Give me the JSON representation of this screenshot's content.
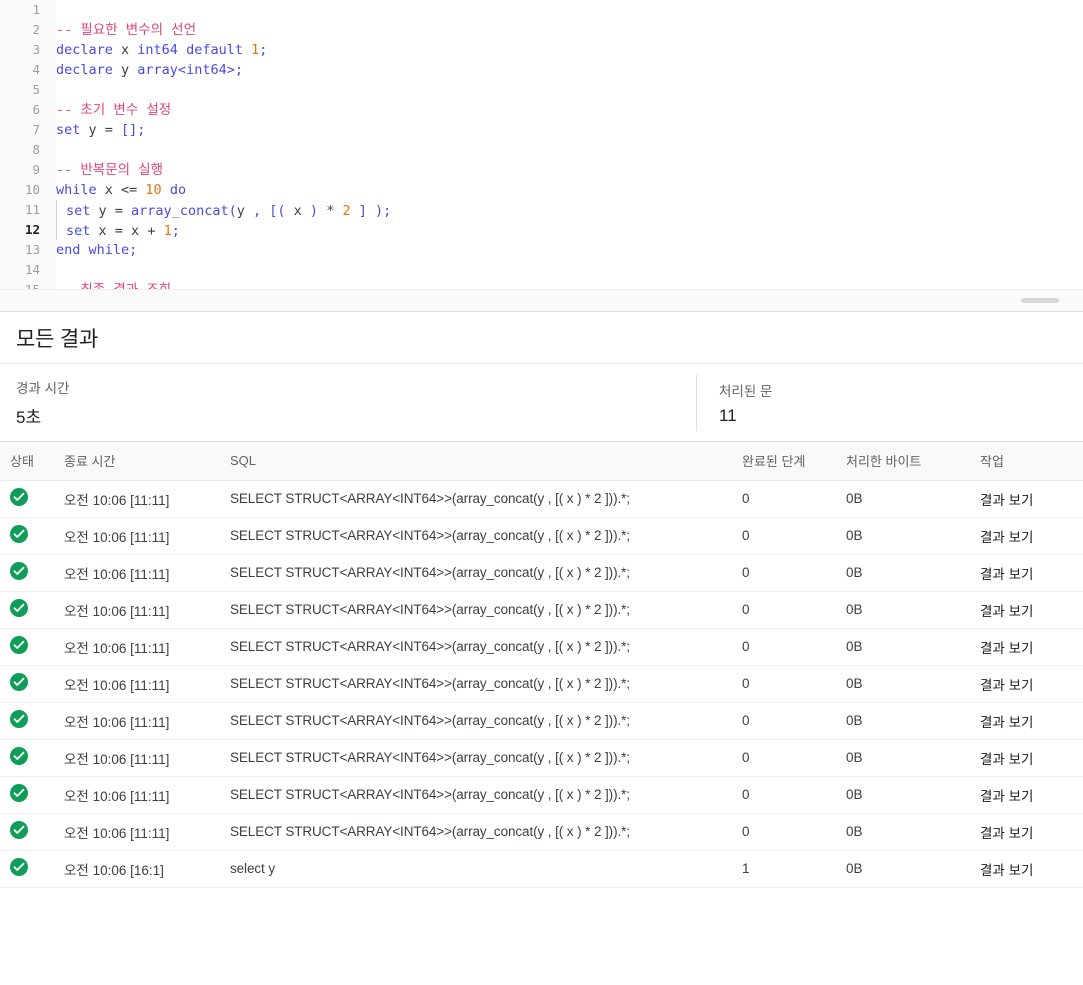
{
  "editor": {
    "name": "sql-script-editor",
    "language": "bigquery-sql",
    "active_line": 12,
    "lines": [
      {
        "n": "1",
        "tokens": []
      },
      {
        "n": "2",
        "tokens": [
          {
            "t": "com",
            "v": "-- 필요한 변수의 선언"
          }
        ]
      },
      {
        "n": "3",
        "tokens": [
          {
            "t": "kw",
            "v": "declare"
          },
          {
            "t": "id",
            "v": " x "
          },
          {
            "t": "type",
            "v": "int64"
          },
          {
            "t": "id",
            "v": " "
          },
          {
            "t": "kw",
            "v": "default"
          },
          {
            "t": "id",
            "v": " "
          },
          {
            "t": "num",
            "v": "1"
          },
          {
            "t": "pun",
            "v": ";"
          }
        ]
      },
      {
        "n": "4",
        "tokens": [
          {
            "t": "kw",
            "v": "declare"
          },
          {
            "t": "id",
            "v": " y "
          },
          {
            "t": "type",
            "v": "array<int64>"
          },
          {
            "t": "pun",
            "v": ";"
          }
        ]
      },
      {
        "n": "5",
        "tokens": []
      },
      {
        "n": "6",
        "tokens": [
          {
            "t": "com",
            "v": "-- 초기 변수 설정"
          }
        ]
      },
      {
        "n": "7",
        "tokens": [
          {
            "t": "kw",
            "v": "set"
          },
          {
            "t": "id",
            "v": " y "
          },
          {
            "t": "op",
            "v": "= "
          },
          {
            "t": "pun",
            "v": "[];"
          }
        ]
      },
      {
        "n": "8",
        "tokens": []
      },
      {
        "n": "9",
        "tokens": [
          {
            "t": "com",
            "v": "-- 반복문의 실행"
          }
        ]
      },
      {
        "n": "10",
        "tokens": [
          {
            "t": "kw",
            "v": "while"
          },
          {
            "t": "id",
            "v": " x "
          },
          {
            "t": "op",
            "v": "<= "
          },
          {
            "t": "num",
            "v": "10"
          },
          {
            "t": "kw",
            "v": " do"
          }
        ]
      },
      {
        "n": "11",
        "indent": true,
        "tokens": [
          {
            "t": "kw",
            "v": "set"
          },
          {
            "t": "id",
            "v": " y "
          },
          {
            "t": "op",
            "v": "= "
          },
          {
            "t": "fn",
            "v": "array_concat"
          },
          {
            "t": "pun",
            "v": "("
          },
          {
            "t": "id",
            "v": "y "
          },
          {
            "t": "pun",
            "v": ", ["
          },
          {
            "t": "pun",
            "v": "( "
          },
          {
            "t": "id",
            "v": "x "
          },
          {
            "t": "pun",
            "v": ") "
          },
          {
            "t": "op",
            "v": "* "
          },
          {
            "t": "num",
            "v": "2"
          },
          {
            "t": "pun",
            "v": " ] );"
          }
        ]
      },
      {
        "n": "12",
        "indent": true,
        "active": true,
        "tokens": [
          {
            "t": "kw",
            "v": "set"
          },
          {
            "t": "id",
            "v": " x "
          },
          {
            "t": "op",
            "v": "= "
          },
          {
            "t": "id",
            "v": "x "
          },
          {
            "t": "op",
            "v": "+ "
          },
          {
            "t": "num",
            "v": "1"
          },
          {
            "t": "pun",
            "v": ";"
          }
        ]
      },
      {
        "n": "13",
        "tokens": [
          {
            "t": "kw",
            "v": "end while"
          },
          {
            "t": "pun",
            "v": ";"
          }
        ]
      },
      {
        "n": "14",
        "tokens": []
      },
      {
        "n": "15",
        "tokens": [
          {
            "t": "com",
            "v": "-- 최종 결과 조회"
          }
        ]
      }
    ],
    "resize_handle_name": "editor-resize-handle"
  },
  "results": {
    "title": "모든 결과",
    "stats": [
      {
        "label": "경과 시간",
        "value": "5초"
      },
      {
        "label": "처리된 문",
        "value": "11"
      }
    ],
    "table": {
      "headers": {
        "status": "상태",
        "end_time": "종료 시간",
        "sql": "SQL",
        "stages": "완료된 단계",
        "bytes": "처리한 바이트",
        "action": "작업"
      },
      "rows": [
        {
          "status": "success",
          "end_time": "오전 10:06 [11:11]",
          "sql": "SELECT STRUCT<ARRAY<INT64>>(array_concat(y , [( x ) * 2 ])).*;",
          "stages": "0",
          "bytes": "0B",
          "action": "결과 보기"
        },
        {
          "status": "success",
          "end_time": "오전 10:06 [11:11]",
          "sql": "SELECT STRUCT<ARRAY<INT64>>(array_concat(y , [( x ) * 2 ])).*;",
          "stages": "0",
          "bytes": "0B",
          "action": "결과 보기"
        },
        {
          "status": "success",
          "end_time": "오전 10:06 [11:11]",
          "sql": "SELECT STRUCT<ARRAY<INT64>>(array_concat(y , [( x ) * 2 ])).*;",
          "stages": "0",
          "bytes": "0B",
          "action": "결과 보기"
        },
        {
          "status": "success",
          "end_time": "오전 10:06 [11:11]",
          "sql": "SELECT STRUCT<ARRAY<INT64>>(array_concat(y , [( x ) * 2 ])).*;",
          "stages": "0",
          "bytes": "0B",
          "action": "결과 보기"
        },
        {
          "status": "success",
          "end_time": "오전 10:06 [11:11]",
          "sql": "SELECT STRUCT<ARRAY<INT64>>(array_concat(y , [( x ) * 2 ])).*;",
          "stages": "0",
          "bytes": "0B",
          "action": "결과 보기"
        },
        {
          "status": "success",
          "end_time": "오전 10:06 [11:11]",
          "sql": "SELECT STRUCT<ARRAY<INT64>>(array_concat(y , [( x ) * 2 ])).*;",
          "stages": "0",
          "bytes": "0B",
          "action": "결과 보기"
        },
        {
          "status": "success",
          "end_time": "오전 10:06 [11:11]",
          "sql": "SELECT STRUCT<ARRAY<INT64>>(array_concat(y , [( x ) * 2 ])).*;",
          "stages": "0",
          "bytes": "0B",
          "action": "결과 보기"
        },
        {
          "status": "success",
          "end_time": "오전 10:06 [11:11]",
          "sql": "SELECT STRUCT<ARRAY<INT64>>(array_concat(y , [( x ) * 2 ])).*;",
          "stages": "0",
          "bytes": "0B",
          "action": "결과 보기"
        },
        {
          "status": "success",
          "end_time": "오전 10:06 [11:11]",
          "sql": "SELECT STRUCT<ARRAY<INT64>>(array_concat(y , [( x ) * 2 ])).*;",
          "stages": "0",
          "bytes": "0B",
          "action": "결과 보기"
        },
        {
          "status": "success",
          "end_time": "오전 10:06 [11:11]",
          "sql": "SELECT STRUCT<ARRAY<INT64>>(array_concat(y , [( x ) * 2 ])).*;",
          "stages": "0",
          "bytes": "0B",
          "action": "결과 보기"
        },
        {
          "status": "success",
          "end_time": "오전 10:06 [16:1]",
          "sql": "select y",
          "stages": "1",
          "bytes": "0B",
          "action": "결과 보기"
        }
      ]
    }
  },
  "colors": {
    "status_success": "#0f9d58",
    "keyword": "#4a4ae0",
    "comment": "#e0457b",
    "number": "#e8710a",
    "text": "#3c4043",
    "muted": "#5f6368",
    "border": "#dadce0"
  }
}
